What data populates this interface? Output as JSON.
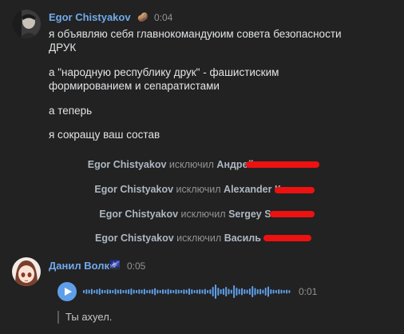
{
  "messages": [
    {
      "author": "Egor Chistyakov",
      "emoji": "🥔",
      "time": "0:04",
      "lines": [
        "я объявляю себя главнокомандуюим совета безопасности",
        "ДРУК",
        "а \"народную республику друк\" - фашистиским",
        "формированием и сепаратистами",
        "а теперь",
        "я сокращу ваш состав"
      ]
    },
    {
      "author": "Данил Волк",
      "emoji": "🌌",
      "time": "0:05",
      "voice": {
        "duration": "0:01",
        "progress": 0
      },
      "reply": "Ты ахуел."
    }
  ],
  "service": [
    {
      "actor": "Egor Chistyakov",
      "verb": "исключил",
      "target": "Андрей"
    },
    {
      "actor": "Egor Chistyakov",
      "verb": "исключил",
      "target": "Alexander К"
    },
    {
      "actor": "Egor Chistyakov",
      "verb": "исключил",
      "target": "Sergey S"
    },
    {
      "actor": "Egor Chistyakov",
      "verb": "исключил",
      "target": "Василь"
    }
  ],
  "colors": {
    "link": "#71aaeb",
    "accent": "#5f9fe9",
    "redaction": "#ee1111"
  }
}
